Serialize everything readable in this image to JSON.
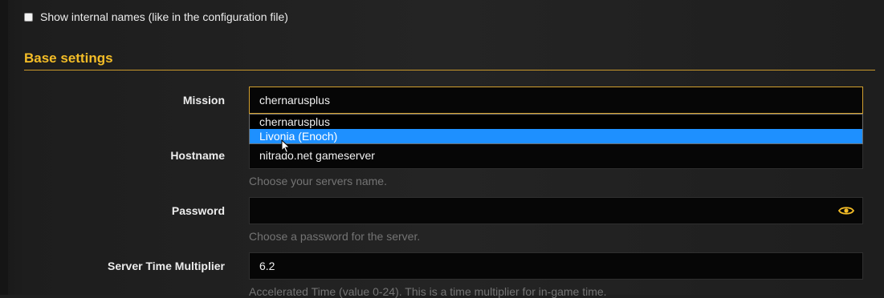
{
  "options": {
    "show_internal_names_label": "Show internal names (like in the configuration file)"
  },
  "section": {
    "title": "Base settings"
  },
  "fields": {
    "mission": {
      "label": "Mission",
      "value": "chernarusplus",
      "dropdown_options": [
        "chernarusplus",
        "Livonia (Enoch)"
      ],
      "highlighted_option": "Livonia (Enoch)"
    },
    "hostname": {
      "label": "Hostname",
      "value": "nitrado.net gameserver",
      "help": "Choose your servers name."
    },
    "password": {
      "label": "Password",
      "value": "",
      "help": "Choose a password for the server.",
      "toggle_icon": "eye-icon"
    },
    "server_time_multiplier": {
      "label": "Server Time Multiplier",
      "value": "6.2",
      "help": "Accelerated Time (value 0-24). This is a time multiplier for in-game time."
    }
  },
  "colors": {
    "accent": "#f4bd27",
    "highlight": "#1e90ff",
    "help_text": "#747474"
  }
}
